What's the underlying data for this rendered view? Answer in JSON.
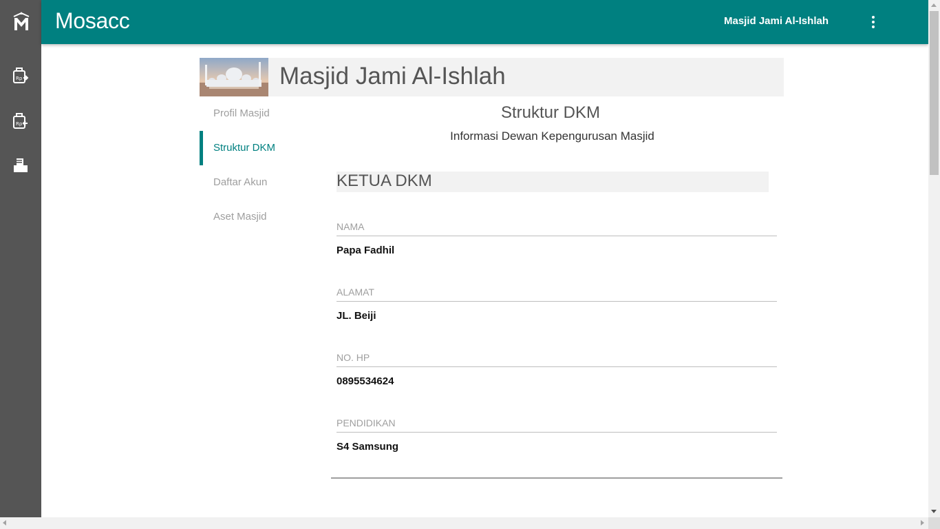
{
  "app": {
    "brand": "Mosacc",
    "account_title": "Masjid Jami Al-Ishlah"
  },
  "rail": {
    "logo_icon": "mosacc-logo-icon",
    "items": [
      "finance-in-icon",
      "finance-out-icon",
      "report-icon"
    ]
  },
  "header": {
    "title": "Masjid Jami Al-Ishlah",
    "image_icon": "mosque-photo"
  },
  "menu": {
    "items": [
      {
        "label": "Profil Masjid",
        "active": false
      },
      {
        "label": "Struktur DKM",
        "active": true
      },
      {
        "label": "Daftar Akun",
        "active": false
      },
      {
        "label": "Aset Masjid",
        "active": false
      }
    ]
  },
  "content": {
    "title": "Struktur DKM",
    "subtitle": "Informasi Dewan Kepengurusan Masjid",
    "section": "KETUA DKM",
    "fields": [
      {
        "label": "NAMA",
        "value": "Papa Fadhil"
      },
      {
        "label": "ALAMAT",
        "value": "JL. Beiji"
      },
      {
        "label": "NO. HP",
        "value": "0895534624"
      },
      {
        "label": "PENDIDIKAN",
        "value": "S4 Samsung"
      }
    ]
  },
  "colors": {
    "primary": "#008080",
    "rail": "#555555",
    "panel": "#f2f2f2"
  }
}
